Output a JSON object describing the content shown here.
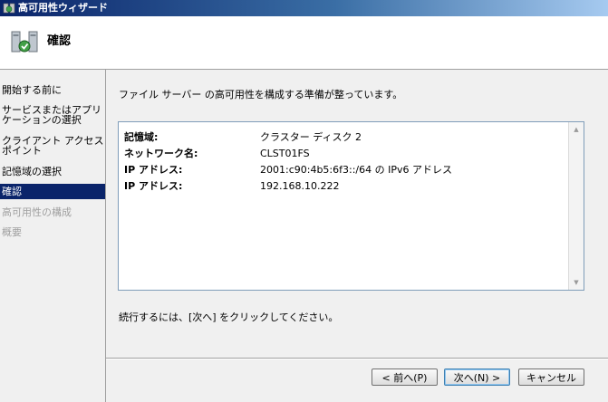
{
  "window": {
    "title": "高可用性ウィザード"
  },
  "header": {
    "title": "確認",
    "icon": "cluster-wizard-icon"
  },
  "sidebar": {
    "steps": [
      {
        "label": "開始する前に",
        "state": "normal"
      },
      {
        "label": "サービスまたはアプリケーションの選択",
        "state": "normal"
      },
      {
        "label": "クライアント アクセス ポイント",
        "state": "normal"
      },
      {
        "label": "記憶域の選択",
        "state": "normal"
      },
      {
        "label": "確認",
        "state": "active"
      },
      {
        "label": "高可用性の構成",
        "state": "disabled"
      },
      {
        "label": "概要",
        "state": "disabled"
      }
    ]
  },
  "main": {
    "intro": "ファイル サーバー の高可用性を構成する準備が整っています。",
    "summary": [
      {
        "key": "記憶域:",
        "value": "クラスター ディスク 2"
      },
      {
        "key": "ネットワーク名:",
        "value": "CLST01FS"
      },
      {
        "key": "IP アドレス:",
        "value": "2001:c90:4b5:6f3::/64 の IPv6 アドレス"
      },
      {
        "key": "IP アドレス:",
        "value": "192.168.10.222"
      }
    ],
    "continue_text": "続行するには、[次へ] をクリックしてください。"
  },
  "buttons": {
    "back": "< 前へ(P)",
    "next": "次へ(N) >",
    "cancel": "キャンセル"
  },
  "colors": {
    "selection": "#0a246a",
    "disabled_text": "#a0a0a0"
  }
}
